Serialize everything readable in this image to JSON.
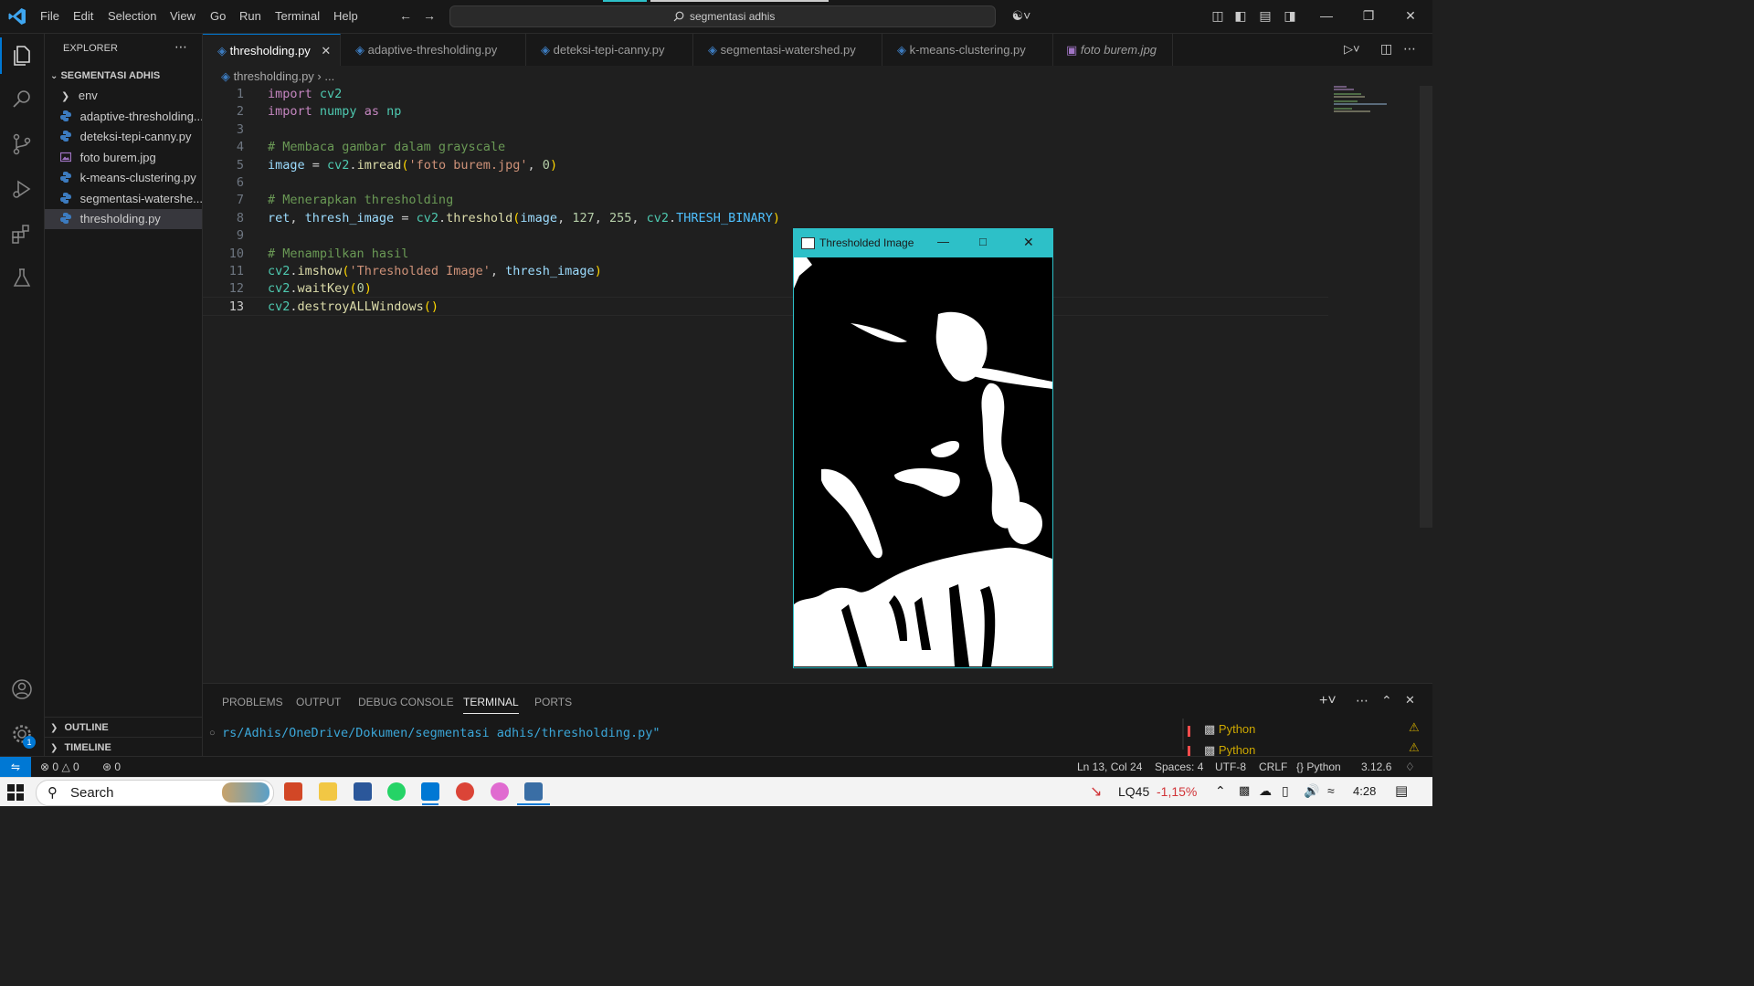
{
  "titlebar": {
    "menu": [
      "File",
      "Edit",
      "Selection",
      "View",
      "Go",
      "Run",
      "Terminal",
      "Help"
    ],
    "search_text": "segmentasi adhis"
  },
  "sidebar": {
    "title": "EXPLORER",
    "folder": "SEGMENTASI ADHIS",
    "items": [
      {
        "label": "env",
        "type": "folder"
      },
      {
        "label": "adaptive-thresholding....",
        "type": "py"
      },
      {
        "label": "deteksi-tepi-canny.py",
        "type": "py"
      },
      {
        "label": "foto burem.jpg",
        "type": "img"
      },
      {
        "label": "k-means-clustering.py",
        "type": "py"
      },
      {
        "label": "segmentasi-watershe...",
        "type": "py"
      },
      {
        "label": "thresholding.py",
        "type": "py"
      }
    ],
    "outline": "OUTLINE",
    "timeline": "TIMELINE"
  },
  "tabs": [
    {
      "label": "thresholding.py",
      "active": true
    },
    {
      "label": "adaptive-thresholding.py"
    },
    {
      "label": "deteksi-tepi-canny.py"
    },
    {
      "label": "segmentasi-watershed.py"
    },
    {
      "label": "k-means-clustering.py"
    },
    {
      "label": "foto burem.jpg"
    }
  ],
  "breadcrumb": {
    "file": "thresholding.py",
    "rest": "..."
  },
  "code": {
    "line_numbers": [
      "1",
      "2",
      "3",
      "4",
      "5",
      "6",
      "7",
      "8",
      "9",
      "10",
      "11",
      "12",
      "13"
    ],
    "l1_kw": "import",
    "l1_mod": "cv2",
    "l2_kw": "import",
    "l2_mod": "numpy",
    "l2_as": "as",
    "l2_alias": "np",
    "l4": "# Membaca gambar dalam grayscale",
    "l5_var": "image",
    "l5_eq": " = ",
    "l5_mod": "cv2",
    "l5_fn": "imread",
    "l5_str": "'foto burem.jpg'",
    "l5_num": "0",
    "l7": "# Menerapkan thresholding",
    "l8_var1": "ret",
    "l8_var2": "thresh_image",
    "l8_mod": "cv2",
    "l8_fn": "threshold",
    "l8_arg": "image",
    "l8_n1": "127",
    "l8_n2": "255",
    "l8_const": "THRESH_BINARY",
    "l10": "# Menampilkan hasil",
    "l11_mod": "cv2",
    "l11_fn": "imshow",
    "l11_str": "'Thresholded Image'",
    "l11_arg": "thresh_image",
    "l12_mod": "cv2",
    "l12_fn": "waitKey",
    "l12_num": "0",
    "l13_mod": "cv2",
    "l13_fn": "destroyALLWindows"
  },
  "panel": {
    "tabs": [
      "PROBLEMS",
      "OUTPUT",
      "DEBUG CONSOLE",
      "TERMINAL",
      "PORTS"
    ],
    "active_tab": "TERMINAL",
    "terminal_text": "rs/Adhis/OneDrive/Dokumen/segmentasi adhis/thresholding.py\"",
    "terminals": [
      "Python",
      "Python"
    ]
  },
  "statusbar": {
    "errors": "0",
    "warnings": "0",
    "ports": "0",
    "position": "Ln 13, Col 24",
    "spaces": "Spaces: 4",
    "encoding": "UTF-8",
    "eol": "CRLF",
    "language": "Python",
    "version": "3.12.6"
  },
  "popup": {
    "title": "Thresholded Image"
  },
  "taskbar": {
    "search": "Search",
    "stock_name": "LQ45",
    "stock_change": "-1,15%",
    "time": "4:28"
  },
  "colors": {
    "accent": "#0078d4",
    "popup_border": "#2dc0c8",
    "stock_down": "#d13438"
  }
}
